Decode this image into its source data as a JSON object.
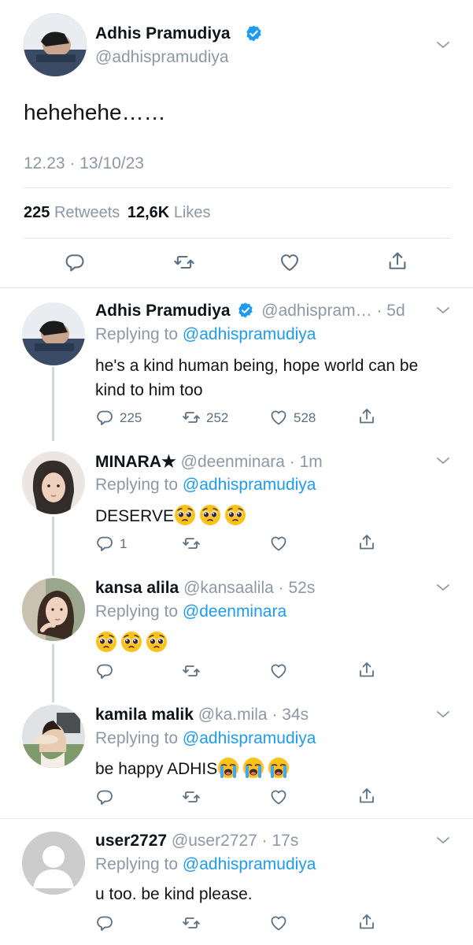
{
  "main_tweet": {
    "author_name": "Adhis Pramudiya",
    "handle": "@adhispramudiya",
    "text": "hehehehe……",
    "timestamp": "12.23 · 13/10/23",
    "retweets_count": "225",
    "retweets_label": "Retweets",
    "likes_count": "12,6K",
    "likes_label": "Likes"
  },
  "replies": [
    {
      "author_name": "Adhis Pramudiya",
      "handle": "@adhispram…",
      "time": "· 5d",
      "replying_prefix": "Replying to",
      "replying_to": "@adhispramudiya",
      "text": "he's a kind human being, hope world can be kind to him too",
      "reply_count": "225",
      "retweet_count": "252",
      "like_count": "528"
    },
    {
      "author_name": "MINARA★",
      "handle": "@deenminara",
      "time": "· 1m",
      "replying_prefix": "Replying to",
      "replying_to": "@adhispramudiya",
      "text": "DESERVE",
      "emoji": [
        "pleading-face",
        "pleading-face",
        "pleading-face"
      ],
      "reply_count": "1"
    },
    {
      "author_name": "kansa alila",
      "handle": "@kansaalila",
      "time": "· 52s",
      "replying_prefix": "Replying to",
      "replying_to": "@deenminara",
      "emoji": [
        "pleading-face",
        "pleading-face",
        "pleading-face"
      ]
    },
    {
      "author_name": "kamila malik",
      "handle": "@ka.mila",
      "time": "· 34s",
      "replying_prefix": "Replying to",
      "replying_to": "@adhispramudiya",
      "text": "be happy ADHIS",
      "emoji": [
        "crying-face",
        "crying-face",
        "crying-face"
      ]
    },
    {
      "author_name": "user2727",
      "handle": "@user2727",
      "time": "· 17s",
      "replying_prefix": "Replying to",
      "replying_to": "@adhispramudiya",
      "text": "u too. be kind please."
    }
  ],
  "colors": {
    "accent": "#1d9bf0",
    "secondary_text": "#8b98a5",
    "verified": "#1d9bf0"
  }
}
